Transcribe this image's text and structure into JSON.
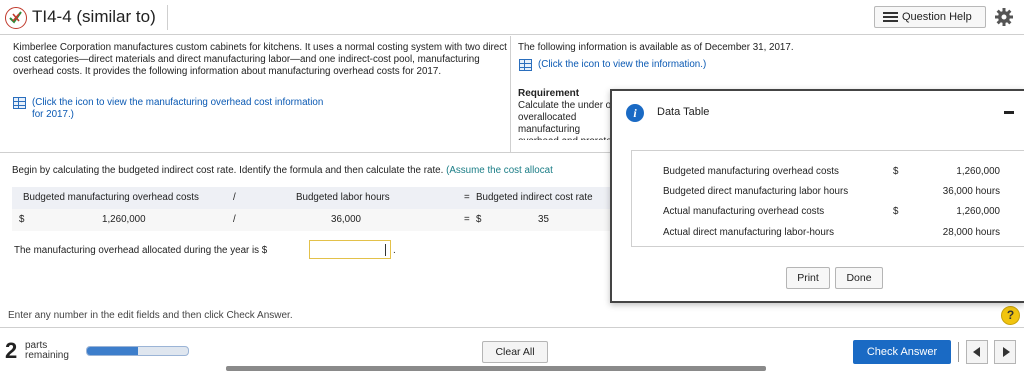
{
  "header": {
    "title": "TI4-4 (similar to)",
    "question_help": "Question Help"
  },
  "problem": {
    "intro": "Kimberlee Corporation manufactures custom cabinets for kitchens. It uses a normal costing system with two direct cost categories—direct materials and direct manufacturing labor—and one indirect-cost pool, manufacturing overhead costs. It provides the following information about manufacturing overhead costs for 2017.",
    "overhead_link": "(Click the icon to view the manufacturing overhead cost information for 2017.)",
    "available_text": "The following information is available as of December 31, 2017.",
    "available_link": "(Click the icon to view the information.)",
    "requirement_title": "Requirement",
    "requirement_text": "Calculate the under or overallocated manufacturing overhead and prorate it to Work-in-Process, Finished Goods, and Cost of Goods Sold based on allocated manufacturing overhead."
  },
  "work": {
    "begin_text": "Begin by calculating the budgeted indirect cost rate. Identify the formula and then calculate the rate.",
    "begin_note": "(Assume the cost allocat",
    "formula": {
      "headers": [
        "Budgeted manufacturing overhead costs",
        "/",
        "Budgeted labor hours",
        "=",
        "Budgeted indirect cost rate"
      ],
      "currency1": "$",
      "value1": "1,260,000",
      "op1": "/",
      "value2": "36,000",
      "op2": "=",
      "currency3": "$",
      "value3": "35"
    },
    "allocated_label": "The manufacturing overhead allocated during the year is $",
    "allocated_value": "",
    "allocated_suffix": "."
  },
  "footer": {
    "instruction": "Enter any number in the edit fields and then click Check Answer.",
    "help_symbol": "?",
    "parts_count": "2",
    "parts_label_1": "parts",
    "parts_label_2": "remaining",
    "progress_fraction": 0.5,
    "clear_all": "Clear All",
    "check_answer": "Check Answer"
  },
  "popup": {
    "info_symbol": "i",
    "title": "Data Table",
    "rows": [
      {
        "label": "Budgeted manufacturing overhead costs",
        "currency": "$",
        "amount": "1,260,000"
      },
      {
        "label": "Budgeted direct manufacturing labor hours",
        "currency": "",
        "amount": "36,000 hours"
      },
      {
        "label": "Actual manufacturing overhead costs",
        "currency": "$",
        "amount": "1,260,000"
      },
      {
        "label": "Actual direct manufacturing labor-hours",
        "currency": "",
        "amount": "28,000 hours"
      }
    ],
    "print": "Print",
    "done": "Done"
  },
  "colors": {
    "accent": "#1a6ac4",
    "link": "#0a59b3",
    "input_border": "#e3c14a",
    "status_icon": "#c0392b"
  }
}
